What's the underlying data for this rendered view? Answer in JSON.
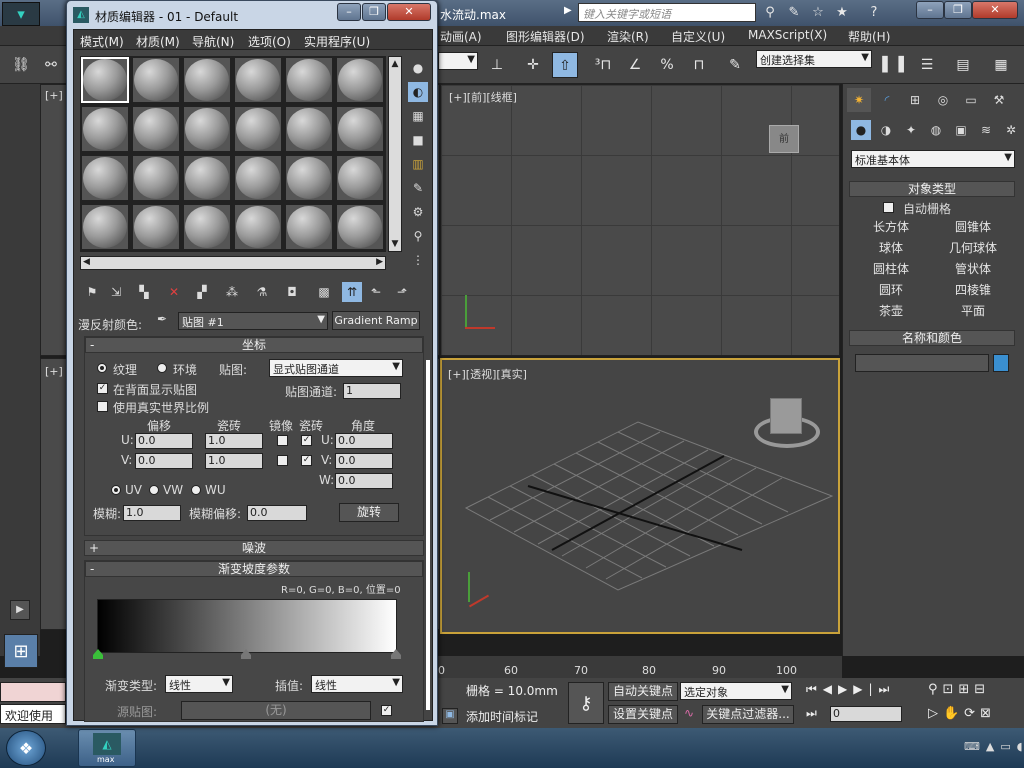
{
  "main": {
    "title": "水流动.max",
    "search_placeholder": "键入关键字或短语",
    "menus": [
      "动画(A)",
      "图形编辑器(D)",
      "渲染(R)",
      "自定义(U)",
      "MAXScript(X)",
      "帮助(H)"
    ],
    "selection_set": "创建选择集",
    "viewports": {
      "top_left": "[+]",
      "front": "[+][前][线框]",
      "left": "[+]",
      "perspective": "[+][透视][真实]"
    },
    "timeline_ticks": [
      "0",
      "60",
      "70",
      "80",
      "90",
      "100"
    ]
  },
  "cmd_panel": {
    "category": "标准基本体",
    "object_type_title": "对象类型",
    "autogrid": "自动栅格",
    "buttons": [
      "长方体",
      "圆锥体",
      "球体",
      "几何球体",
      "圆柱体",
      "管状体",
      "圆环",
      "四棱锥",
      "茶壶",
      "平面"
    ],
    "name_color_title": "名称和颜色"
  },
  "bottom": {
    "welcome": "欢迎使用",
    "grid": "栅格 = 10.0mm",
    "add_time_tag": "添加时间标记",
    "auto_key": "自动关键点",
    "set_key": "设置关键点",
    "selected_object": "选定对象",
    "key_filter": "关键点过滤器...",
    "frame": "0"
  },
  "mat_editor": {
    "title": "材质编辑器 - 01 - Default",
    "menus": [
      "模式(M)",
      "材质(M)",
      "导航(N)",
      "选项(O)",
      "实用程序(U)"
    ],
    "diffuse_label": "漫反射颜色:",
    "map_name": "贴图 #1",
    "map_type": "Gradient Ramp",
    "coords": {
      "title": "坐标",
      "texture": "纹理",
      "environ": "环境",
      "mapping_label": "贴图:",
      "mapping_value": "显式贴图通道",
      "show_back": "在背面显示贴图",
      "real_world": "使用真实世界比例",
      "channel_label": "贴图通道:",
      "channel_value": "1",
      "offset": "偏移",
      "tiling": "瓷砖",
      "mirror": "镜像",
      "tile": "瓷砖",
      "angle": "角度",
      "u_label": "U:",
      "v_label": "V:",
      "w_label": "W:",
      "u_offset": "0.0",
      "v_offset": "0.0",
      "u_tiling": "1.0",
      "v_tiling": "1.0",
      "u_angle": "0.0",
      "v_angle": "0.0",
      "w_angle": "0.0",
      "uv": "UV",
      "vw": "VW",
      "wu": "WU",
      "blur_label": "模糊:",
      "blur_value": "1.0",
      "blur_offset_label": "模糊偏移:",
      "blur_offset_value": "0.0",
      "rotate": "旋转"
    },
    "noise_title": "噪波",
    "gradient": {
      "title": "渐变坡度参数",
      "info": "R=0, G=0, B=0,  位置=0",
      "type_label": "渐变类型:",
      "type_value": "线性",
      "interp_label": "插值:",
      "interp_value": "线性",
      "source_label": "源贴图:",
      "source_value": "(无)"
    }
  },
  "taskbar": {
    "app_label": "max"
  },
  "colors": {
    "accent": "#e8a22a",
    "swatch": "#3a8fd0"
  }
}
